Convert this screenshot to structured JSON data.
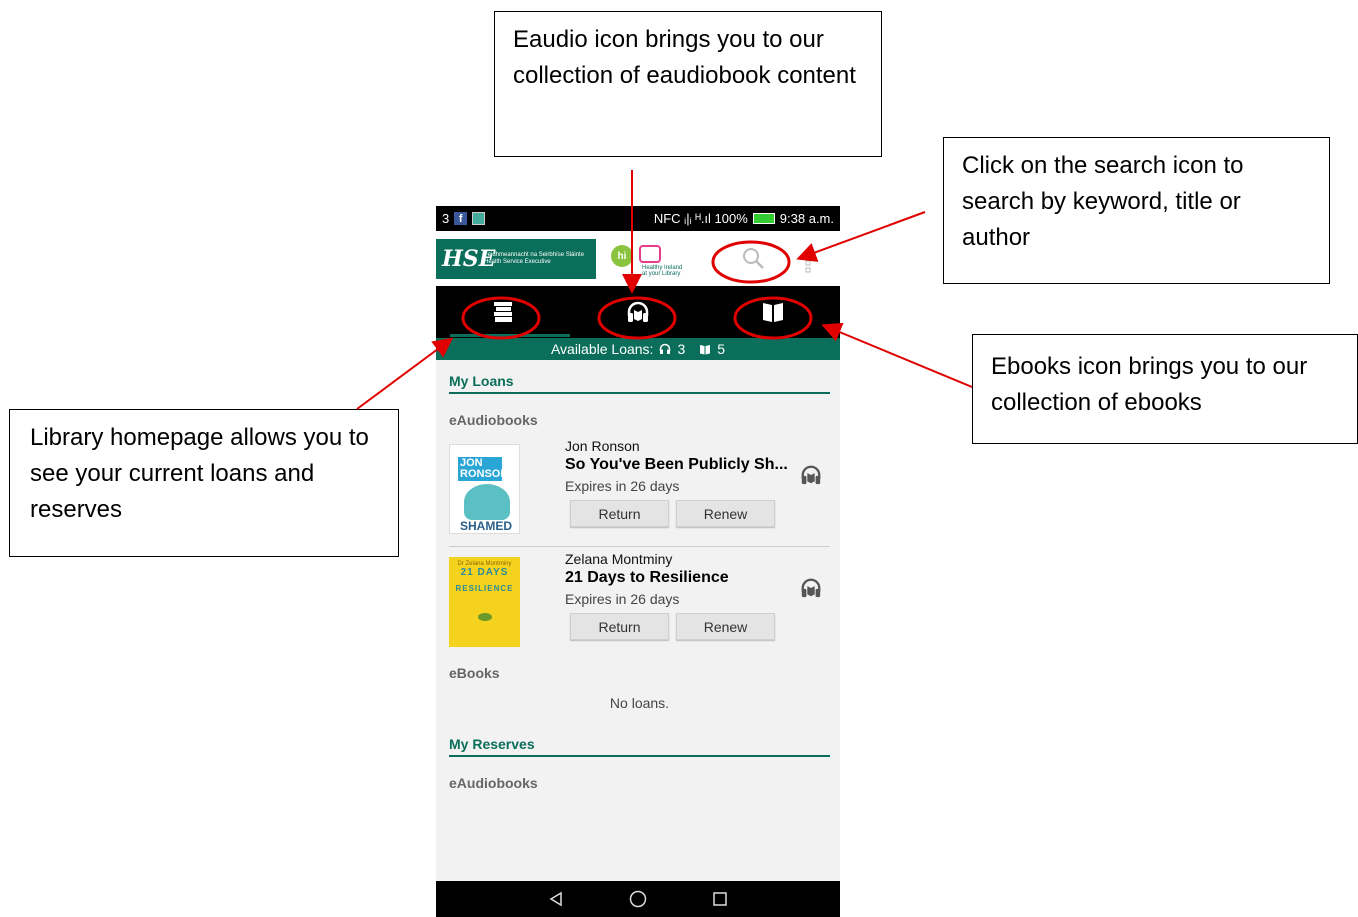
{
  "callouts": {
    "eaudio": "Eaudio icon brings you to our collection of eaudiobook content",
    "search": "Click on the search icon to search by keyword, title or author",
    "ebooks": "Ebooks icon brings you to our collection of ebooks",
    "library": "Library homepage allows you to see your current loans and reserves"
  },
  "status_bar": {
    "left_text": "3",
    "right_text": "NFC ᵢ|ᵢ ᴴ.ıl 100%",
    "time": "9:38 a.m."
  },
  "header": {
    "brand_logo": "HSE",
    "brand_line1": "Feidhmeannacht na Seirbhíse Sláinte",
    "brand_line2": "Health Service Executive",
    "partner_logo": "hi",
    "partner_text_line1": "Healthy Ireland",
    "partner_text_line2": "at your Library"
  },
  "tabs": {
    "home_icon": "library-icon",
    "audio_icon": "headphones-icon",
    "ebook_icon": "book-icon"
  },
  "available_loans": {
    "label": "Available Loans:",
    "audio_count": "3",
    "ebook_count": "5"
  },
  "my_loans": {
    "title": "My Loans",
    "eaudiobooks_label": "eAudiobooks",
    "books": [
      {
        "author": "Jon Ronson",
        "title": "So You've Been Publicly Sh...",
        "expiry": "Expires in 26 days",
        "cover_line1": "JON RONSON",
        "cover_line2": "SHAMED",
        "return_label": "Return",
        "renew_label": "Renew"
      },
      {
        "author": "Zelana Montminy",
        "title": "21 Days to Resilience",
        "expiry": "Expires in 26 days",
        "cover_line1": "Dr Zelana Montminy",
        "cover_line2": "21 DAYS",
        "cover_line3": "RESILIENCE",
        "return_label": "Return",
        "renew_label": "Renew"
      }
    ],
    "ebooks_label": "eBooks",
    "ebooks_empty": "No loans."
  },
  "my_reserves": {
    "title": "My Reserves",
    "eaudiobooks_label": "eAudiobooks"
  },
  "colors": {
    "brand_green": "#0b6e5a",
    "highlight_red": "#e00000",
    "arrow_red": "#e00000"
  }
}
